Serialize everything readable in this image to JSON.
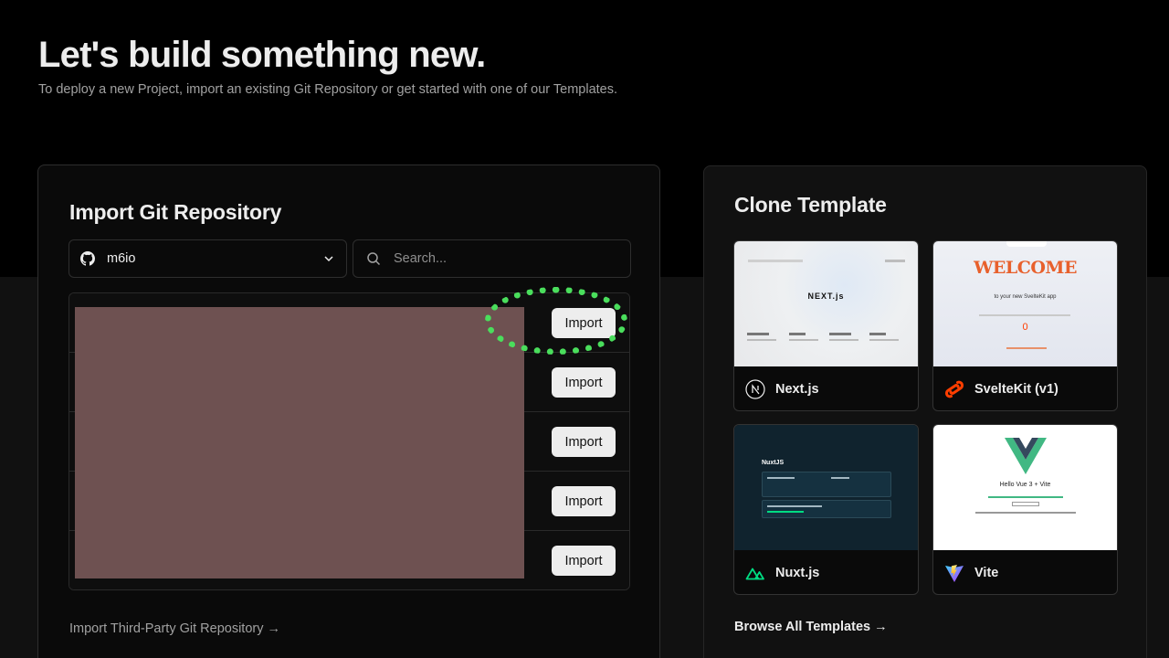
{
  "page": {
    "title": "Let's build something new.",
    "subtitle": "To deploy a new Project, import an existing Git Repository or get started with one of our Templates."
  },
  "import_panel": {
    "title": "Import Git Repository",
    "scope_value": "m6io",
    "search_placeholder": "Search...",
    "repos": [
      {
        "button_label": "Import"
      },
      {
        "button_label": "Import"
      },
      {
        "button_label": "Import"
      },
      {
        "button_label": "Import"
      },
      {
        "button_label": "Import"
      }
    ],
    "third_party_link": "Import Third-Party Git Repository →"
  },
  "template_panel": {
    "title": "Clone Template",
    "templates": [
      {
        "name": "Next.js",
        "icon": "nextjs-icon",
        "preview_text": "NEXT.js"
      },
      {
        "name": "SvelteKit (v1)",
        "icon": "svelte-icon",
        "preview_text": "WELCOME",
        "preview_sub": "to your new SvelteKit app",
        "preview_counter": "0"
      },
      {
        "name": "Nuxt.js",
        "icon": "nuxt-icon",
        "preview_text": "NuxtJS"
      },
      {
        "name": "Vite",
        "icon": "vite-icon",
        "preview_text": "Hello Vue 3 + Vite"
      }
    ],
    "browse_all_link": "Browse All Templates →"
  },
  "colors": {
    "highlight": "#4ade5c",
    "redacted": "#6e5151",
    "svelte": "#ff3e00",
    "nuxt": "#00dc82",
    "vue_green": "#41b883",
    "vue_dark": "#35495e"
  }
}
